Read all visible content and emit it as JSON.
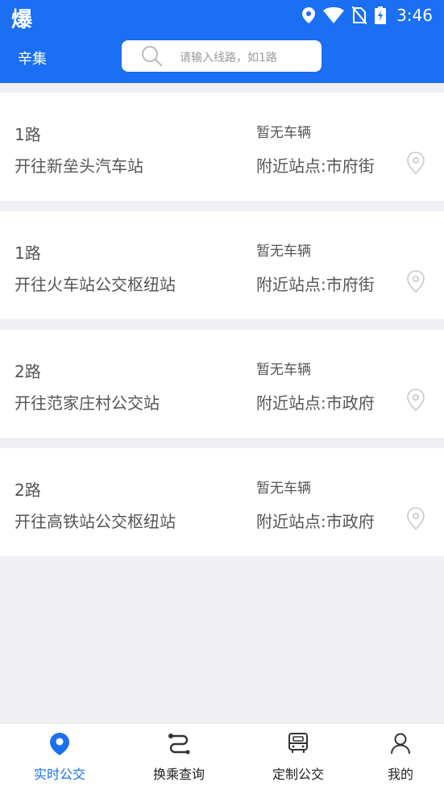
{
  "status_bar": {
    "app_glyph": "爆",
    "time": "3:46",
    "icons": [
      "location-icon",
      "wifi-icon",
      "no-sim-icon",
      "battery-icon"
    ]
  },
  "header": {
    "city": "辛集",
    "search_placeholder": "请输入线路，如1路"
  },
  "routes": [
    {
      "name": "1路",
      "destination": "开往新垒头汽车站",
      "vehicle_status": "暂无车辆",
      "nearby": "附近站点:市府街"
    },
    {
      "name": "1路",
      "destination": "开往火车站公交枢纽站",
      "vehicle_status": "暂无车辆",
      "nearby": "附近站点:市府街"
    },
    {
      "name": "2路",
      "destination": "开往范家庄村公交站",
      "vehicle_status": "暂无车辆",
      "nearby": "附近站点:市政府"
    },
    {
      "name": "2路",
      "destination": "开往高铁站公交枢纽站",
      "vehicle_status": "暂无车辆",
      "nearby": "附近站点:市政府"
    }
  ],
  "tabs": [
    {
      "label": "实时公交",
      "icon": "map-pin-icon",
      "active": true
    },
    {
      "label": "换乘查询",
      "icon": "route-icon",
      "active": false
    },
    {
      "label": "定制公交",
      "icon": "bus-icon",
      "active": false
    },
    {
      "label": "我的",
      "icon": "user-icon",
      "active": false
    }
  ],
  "colors": {
    "accent": "#1a6ff2",
    "background": "#efeff4",
    "text": "#555555"
  }
}
